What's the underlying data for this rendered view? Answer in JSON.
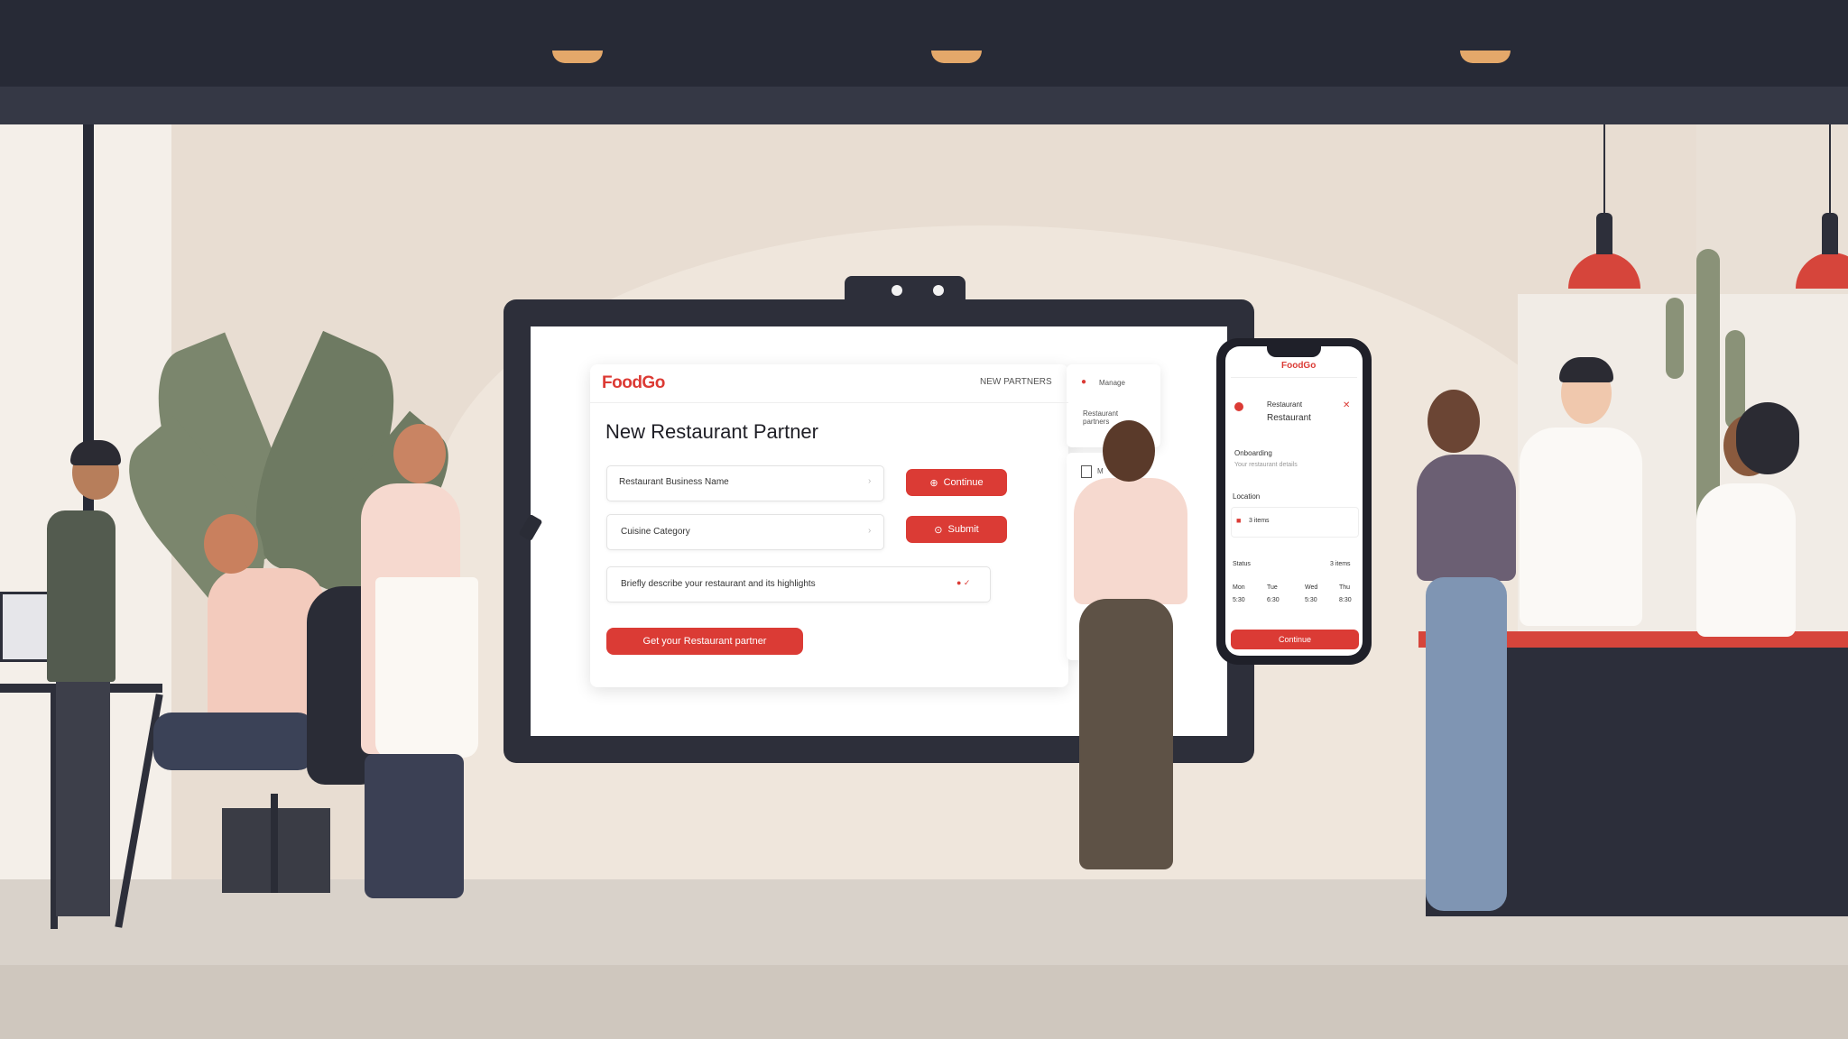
{
  "screen": {
    "brand": "FoodGo",
    "nav_link": "NEW PARTNERS",
    "form_title": "New Restaurant Partner",
    "fields": [
      {
        "text": "Restaurant Business Name",
        "action": "Continue"
      },
      {
        "text": "Cuisine Category",
        "action": "Submit"
      },
      {
        "text": "Briefly describe your restaurant and its highlights"
      }
    ],
    "submit_label": "Get your Restaurant partner",
    "side_panel": {
      "item1": "Manage",
      "item2": "Restaurant partners",
      "item3": "M"
    }
  },
  "phone": {
    "brand": "FoodGo",
    "card_title": "Restaurant",
    "card_sub": "Restaurant",
    "section1": "Onboarding",
    "section1_sub": "Your restaurant details",
    "section2": "Location",
    "row_label": "Status",
    "row_value": "3 items",
    "table_headers": [
      "Mon",
      "Tue",
      "Wed",
      "Thu"
    ],
    "table_values": [
      "5:30",
      "6:30",
      "5:30",
      "8:30"
    ],
    "button_label": "Continue"
  },
  "colors": {
    "accent": "#db3b35",
    "ceiling": "#272a36",
    "wall": "#e8ddd2"
  }
}
